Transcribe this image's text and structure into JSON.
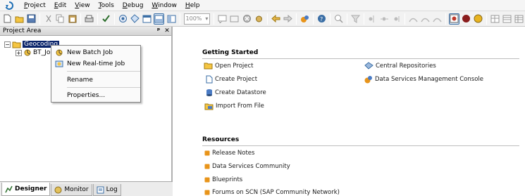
{
  "menubar": {
    "items": [
      "Project",
      "Edit",
      "View",
      "Tools",
      "Debug",
      "Window",
      "Help"
    ]
  },
  "toolbar": {
    "zoom_value": "100%"
  },
  "project_area": {
    "title": "Project Area",
    "pin_glyph": "ᵖ",
    "close_glyph": "✕",
    "tree": {
      "root_label": "Geocoding",
      "child_label": "BT_Jo"
    }
  },
  "context_menu": {
    "items": [
      "New Batch Job",
      "New Real-time Job",
      "Rename",
      "Properties..."
    ]
  },
  "bottom_tabs": [
    "Designer",
    "Monitor",
    "Log"
  ],
  "getting_started": {
    "title": "Getting Started",
    "links_left": [
      "Open Project",
      "Create Project",
      "Create Datastore",
      "Import From File"
    ],
    "links_right": [
      "Central Repositories",
      "Data Services Management Console"
    ]
  },
  "resources": {
    "title": "Resources",
    "links": [
      "Release Notes",
      "Data Services Community",
      "Blueprints",
      "Forums on SCN (SAP Community Network)"
    ]
  },
  "colors": {
    "selection": "#0a246a",
    "folder": "#f5c542",
    "orange_icon": "#e8941a"
  }
}
